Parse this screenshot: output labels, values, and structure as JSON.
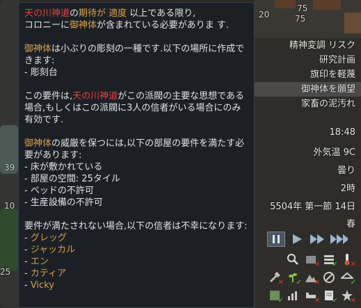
{
  "world": {
    "numbers": [
      "20",
      "75",
      "75",
      "39",
      "10",
      "25"
    ]
  },
  "tooltip": {
    "paragraphs": [
      [
        {
          "text": "天の川神道",
          "color": "red"
        },
        {
          "text": "の",
          "color": ""
        },
        {
          "text": "期待が 適度",
          "color": "gold"
        },
        {
          "text": " 以上である限り,",
          "color": ""
        }
      ]
    ],
    "line1b": "コロニーに",
    "line1c": "御神体",
    "line1d": "が含まれている必要がありま す.",
    "p2a": "御神体",
    "p2b": "は小ぶりの彫刻の一種です.以下の場所に作成できます:",
    "p2c": " - 彫刻台",
    "p3a": "この要件は,",
    "p3b": "天の川神道",
    "p3c": "がこの派閥の主要な思想である場合,もしくはこの派閥に3人の信者がいる場合にのみ有効です.",
    "p4a": "御神体",
    "p4b": "の威厳を保つには,以下の部屋の要件を満たす必要があります:",
    "p4_items": [
      " - 床が敷かれている",
      " - 部屋の空間: 25タイル",
      " - ベッドの不許可",
      " - 生産設備の不許可"
    ],
    "p5": "要件が満たされない場合,以下の信者は不幸になります:",
    "believers": [
      "グレッグ",
      "ジャッカル",
      "エン",
      "カティア",
      "Vicky"
    ],
    "bullet": " - "
  },
  "menu": [
    {
      "label": "精神変調 リスク",
      "active": false
    },
    {
      "label": "研究計画",
      "active": false
    },
    {
      "label": "旗印を軽蔑",
      "active": false
    },
    {
      "label": "御神体を願望",
      "active": true
    },
    {
      "label": "家畜の泥汚れ",
      "active": false
    }
  ],
  "info": {
    "time": "18:48",
    "temperature": "外気温 9C",
    "weather": "曇り",
    "hour": "2時",
    "date": "5504年 第一節 14日",
    "season": "春"
  },
  "icons": [
    [
      "search-icon",
      "area-icon",
      "stack-icon",
      "temperature-icon"
    ],
    [
      "hammer-icon",
      "growing-icon",
      "mountain-icon",
      "globe-icon",
      "roof-icon"
    ],
    [
      "zone-icon",
      "chart-icon",
      "bed-icon",
      "note-icon",
      "beauty-icon"
    ]
  ],
  "colors": {
    "red": "#e4423a",
    "gold": "#d7a04b",
    "tooltip_bg": "#1c2026"
  }
}
